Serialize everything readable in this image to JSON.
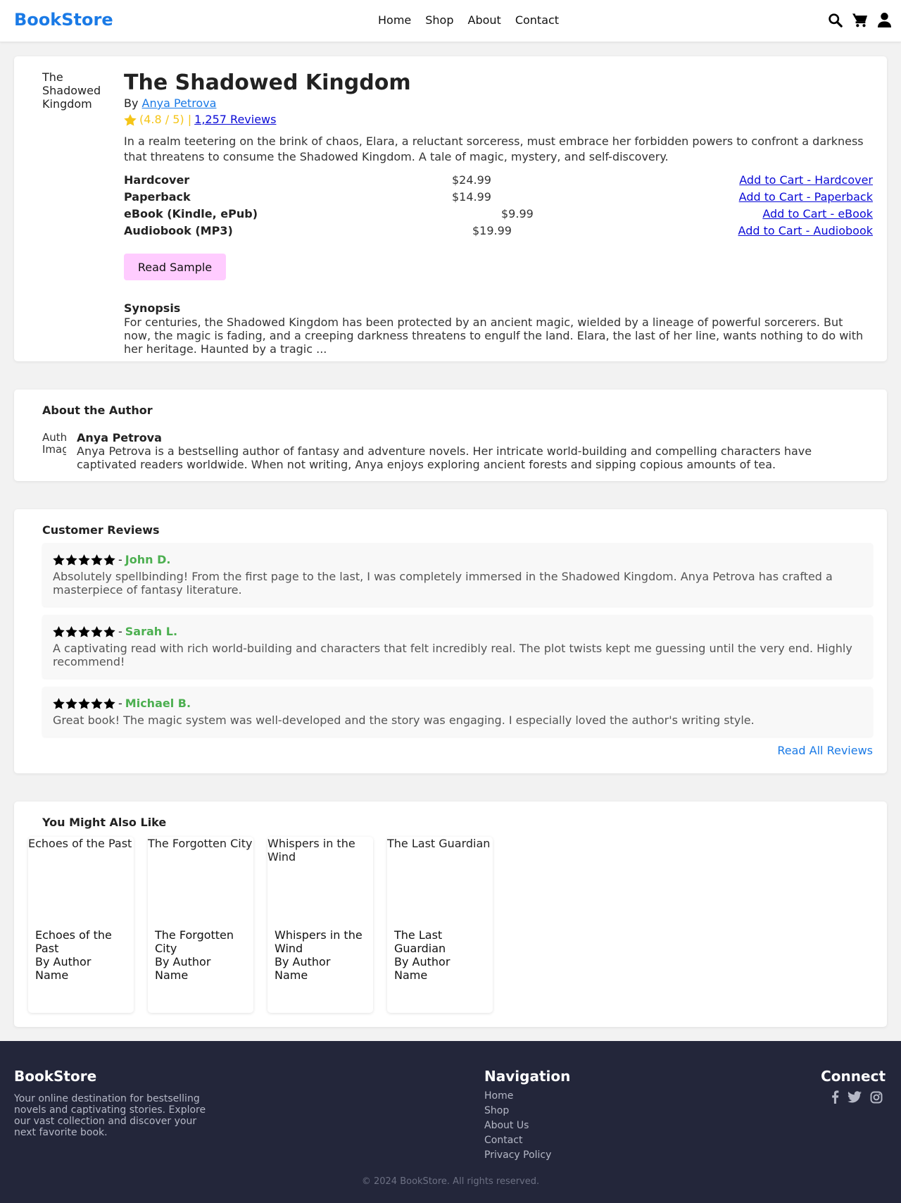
{
  "header": {
    "logo": "BookStore",
    "nav": [
      "Home",
      "Shop",
      "About",
      "Contact"
    ],
    "icons": [
      "search-icon",
      "cart-icon",
      "user-icon"
    ]
  },
  "book": {
    "cover_alt": "The Shadowed Kingdom",
    "title": "The Shadowed Kingdom",
    "by_label": "By",
    "author": "Anya Petrova",
    "rating_text": "(4.8 / 5) |",
    "reviews_link": "1,257 Reviews",
    "blurb": "In a realm teetering on the brink of chaos, Elara, a reluctant sorceress, must embrace her forbidden powers to confront a darkness that threatens to consume the Shadowed Kingdom. A tale of magic, mystery, and self-discovery.",
    "formats": [
      {
        "name": "Hardcover",
        "price": "$24.99",
        "cart": "Add to Cart - Hardcover"
      },
      {
        "name": "Paperback",
        "price": "$14.99",
        "cart": "Add to Cart - Paperback"
      },
      {
        "name": "eBook (Kindle, ePub)",
        "price": "$9.99",
        "cart": "Add to Cart - eBook"
      },
      {
        "name": "Audiobook (MP3)",
        "price": "$19.99",
        "cart": "Add to Cart - Audiobook"
      }
    ],
    "sample_button": "Read Sample",
    "synopsis_title": "Synopsis",
    "synopsis": "For centuries, the Shadowed Kingdom has been protected by an ancient magic, wielded by a lineage of powerful sorcerers. But now, the magic is fading, and a creeping darkness threatens to engulf the land. Elara, the last of her line, wants nothing to do with her heritage. Haunted by a tragic ..."
  },
  "author_section": {
    "title": "About the Author",
    "image_alt": "Author Image",
    "name": "Anya Petrova",
    "bio": "Anya Petrova is a bestselling author of fantasy and adventure novels. Her intricate world-building and compelling characters have captivated readers worldwide. When not writing, Anya enjoys exploring ancient forests and sipping copious amounts of tea."
  },
  "reviews": {
    "title": "Customer Reviews",
    "items": [
      {
        "stars": 5,
        "sep": "-",
        "name": "John D.",
        "text": "Absolutely spellbinding! From the first page to the last, I was completely immersed in the Shadowed Kingdom. Anya Petrova has crafted a masterpiece of fantasy literature."
      },
      {
        "stars": 5,
        "sep": "-",
        "name": "Sarah L.",
        "text": "A captivating read with rich world-building and characters that felt incredibly real. The plot twists kept me guessing until the very end. Highly recommend!"
      },
      {
        "stars": 5,
        "sep": "-",
        "name": "Michael B.",
        "text": "Great book! The magic system was well-developed and the story was engaging. I especially loved the author's writing style."
      }
    ],
    "read_all": "Read All Reviews"
  },
  "recommendations": {
    "title": "You Might Also Like",
    "items": [
      {
        "alt": "Echoes of the Past",
        "title": "Echoes of the Past",
        "author": "By Author Name"
      },
      {
        "alt": "The Forgotten City",
        "title": "The Forgotten City",
        "author": "By Author Name"
      },
      {
        "alt": "Whispers in the Wind",
        "title": "Whispers in the Wind",
        "author": "By Author Name"
      },
      {
        "alt": "The Last Guardian",
        "title": "The Last Guardian",
        "author": "By Author Name"
      }
    ]
  },
  "footer": {
    "brand": "BookStore",
    "description": "Your online destination for bestselling novels and captivating stories. Explore our vast collection and discover your next favorite book.",
    "nav_title": "Navigation",
    "nav": [
      "Home",
      "Shop",
      "About Us",
      "Contact",
      "Privacy Policy"
    ],
    "connect_title": "Connect",
    "social_icons": [
      "facebook-icon",
      "twitter-icon",
      "instagram-icon"
    ],
    "copyright": "© 2024 BookStore. All rights reserved."
  },
  "colors": {
    "brand": "#1a7ae6",
    "star": "#f5c518",
    "reviewer": "#4caf50",
    "sample_button": "#ffccff",
    "footer_bg": "#23263a"
  }
}
